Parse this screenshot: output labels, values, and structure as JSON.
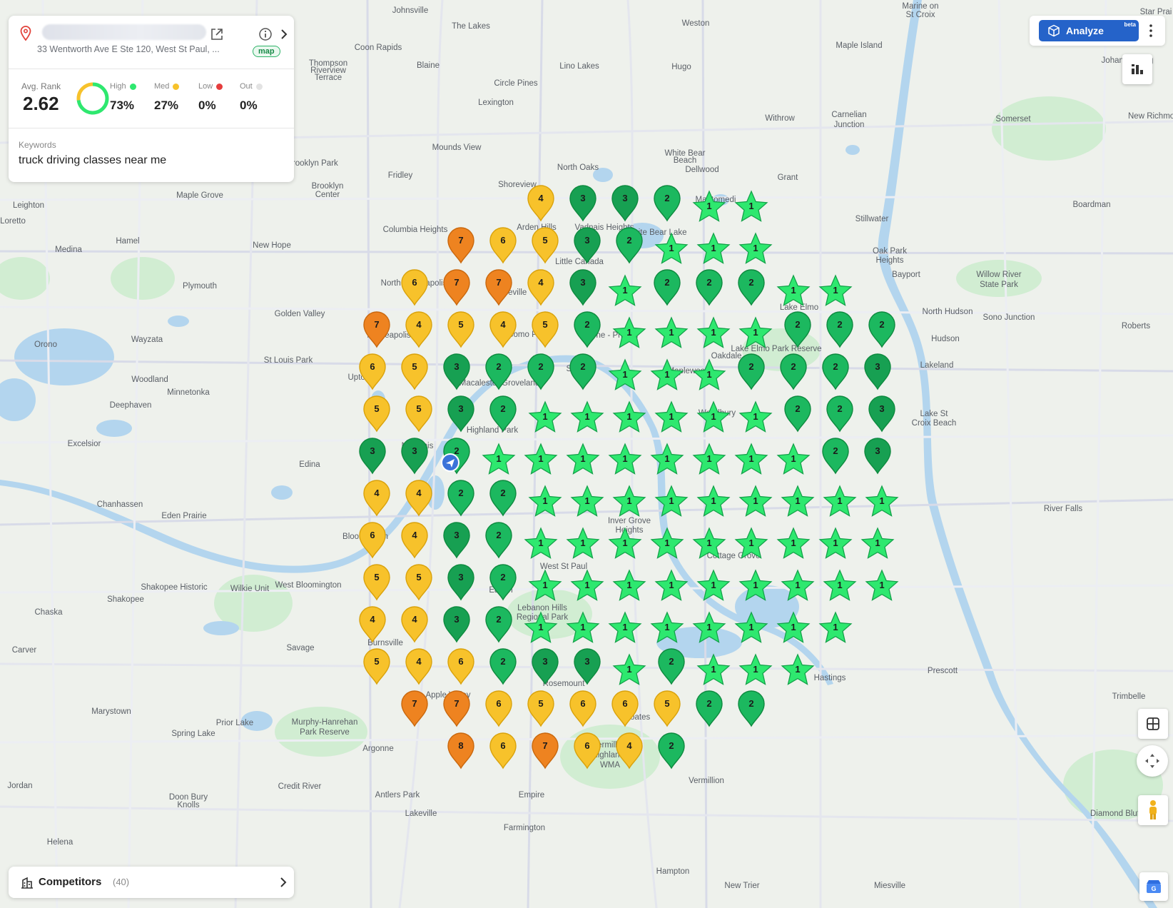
{
  "header": {
    "address": "33 Wentworth Ave E Ste 120, West St Paul, ...",
    "map_badge": "map"
  },
  "stats": {
    "avg_rank_label": "Avg. Rank",
    "avg_rank": "2.62",
    "high_label": "High",
    "high_pct": "73%",
    "med_label": "Med",
    "med_pct": "27%",
    "low_label": "Low",
    "low_pct": "0%",
    "out_label": "Out",
    "out_pct": "0%",
    "high_fraction": 0.73,
    "med_fraction": 0.27
  },
  "keywords": {
    "label": "Keywords",
    "value": "truck driving classes near me"
  },
  "competitors": {
    "label": "Competitors",
    "count": "(40)"
  },
  "toolbar": {
    "analyze_label": "Analyze",
    "beta_label": "beta"
  },
  "colors": {
    "rank_1": "#2ee86f",
    "rank_2": "#1cb85f",
    "rank_3": "#17a052",
    "rank_4_6": "#f7c22b",
    "rank_7_8": "#ee8320",
    "accent": "#2563c9"
  },
  "rank_grid": [
    [
      null,
      null,
      null,
      null,
      4,
      3,
      3,
      2,
      1,
      1,
      null,
      null,
      null,
      null
    ],
    [
      null,
      null,
      7,
      6,
      5,
      3,
      2,
      1,
      1,
      1,
      null,
      null,
      null,
      null
    ],
    [
      null,
      6,
      7,
      7,
      4,
      3,
      1,
      2,
      2,
      2,
      1,
      1,
      null,
      null
    ],
    [
      7,
      4,
      5,
      4,
      5,
      2,
      1,
      1,
      1,
      1,
      2,
      2,
      2,
      null
    ],
    [
      6,
      5,
      3,
      2,
      2,
      2,
      1,
      1,
      1,
      2,
      2,
      2,
      3,
      null
    ],
    [
      5,
      5,
      3,
      2,
      1,
      1,
      1,
      1,
      1,
      1,
      2,
      2,
      3,
      null
    ],
    [
      3,
      3,
      2,
      1,
      1,
      1,
      1,
      1,
      1,
      1,
      1,
      2,
      3,
      null
    ],
    [
      4,
      4,
      2,
      2,
      1,
      1,
      1,
      1,
      1,
      1,
      1,
      1,
      1,
      null
    ],
    [
      6,
      4,
      3,
      2,
      1,
      1,
      1,
      1,
      1,
      1,
      1,
      1,
      1,
      null
    ],
    [
      5,
      5,
      3,
      2,
      1,
      1,
      1,
      1,
      1,
      1,
      1,
      1,
      1,
      null
    ],
    [
      4,
      4,
      3,
      2,
      1,
      1,
      1,
      1,
      1,
      1,
      1,
      1,
      null,
      null
    ],
    [
      5,
      4,
      6,
      2,
      3,
      3,
      1,
      2,
      1,
      1,
      1,
      null,
      null,
      null
    ],
    [
      null,
      7,
      7,
      6,
      5,
      6,
      6,
      5,
      2,
      2,
      null,
      null,
      null,
      null
    ],
    [
      null,
      null,
      8,
      6,
      7,
      6,
      4,
      2,
      null,
      null,
      null,
      null,
      null,
      null
    ]
  ],
  "place_labels": [
    [
      "Johnsville",
      575,
      18
    ],
    [
      "The Lakes",
      660,
      40
    ],
    [
      "Weston",
      975,
      36
    ],
    [
      "Marine on",
      1290,
      12
    ],
    [
      "St Croix",
      1290,
      24
    ],
    [
      "Star Prai",
      1620,
      20
    ],
    [
      "Coon Rapids",
      530,
      70
    ],
    [
      "Thompson",
      460,
      92
    ],
    [
      "Riverview",
      460,
      102
    ],
    [
      "Terrace",
      460,
      112
    ],
    [
      "Blaine",
      600,
      95
    ],
    [
      "Lino Lakes",
      812,
      96
    ],
    [
      "Hugo",
      955,
      97
    ],
    [
      "Maple Island",
      1204,
      67
    ],
    [
      "Johannesburg",
      1580,
      88
    ],
    [
      "Circle Pines",
      723,
      120
    ],
    [
      "Lexington",
      695,
      147
    ],
    [
      "Withrow",
      1093,
      169
    ],
    [
      "Carnelian",
      1190,
      164
    ],
    [
      "Junction",
      1190,
      178
    ],
    [
      "Somerset",
      1420,
      170
    ],
    [
      "Mounds View",
      640,
      210
    ],
    [
      "New Richmond",
      1620,
      166
    ],
    [
      "Brooklyn Park",
      438,
      232
    ],
    [
      "North Oaks",
      810,
      238
    ],
    [
      "White Bear",
      960,
      218
    ],
    [
      "Beach",
      960,
      228
    ],
    [
      "Dellwood",
      984,
      241
    ],
    [
      "Fridley",
      561,
      249
    ],
    [
      "Grant",
      1104,
      252
    ],
    [
      "Brooklyn",
      459,
      264
    ],
    [
      "Center",
      459,
      276
    ],
    [
      "Maple Grove",
      280,
      277
    ],
    [
      "Leighton",
      40,
      291
    ],
    [
      "Boardman",
      1530,
      290
    ],
    [
      "Loretto",
      18,
      313
    ],
    [
      "Stillwater",
      1222,
      310
    ],
    [
      "Hamel",
      179,
      341
    ],
    [
      "Medina",
      96,
      353
    ],
    [
      "New Hope",
      381,
      347
    ],
    [
      "Oak Park",
      1247,
      355
    ],
    [
      "Heights",
      1247,
      368
    ],
    [
      "Bayport",
      1270,
      388
    ],
    [
      "Willow River",
      1400,
      388
    ],
    [
      "State Park",
      1400,
      402
    ],
    [
      "Plymouth",
      280,
      404
    ],
    [
      "Golden Valley",
      420,
      443
    ],
    [
      "North Hudson",
      1328,
      440
    ],
    [
      "Sono Junction",
      1414,
      448
    ],
    [
      "Roberts",
      1592,
      460
    ],
    [
      "Lake Elmo",
      1120,
      434
    ],
    [
      "Minneapolis",
      545,
      473
    ],
    [
      "St Paul",
      812,
      520
    ],
    [
      "Hudson",
      1325,
      478
    ],
    [
      "Orono",
      64,
      486
    ],
    [
      "Wayzata",
      206,
      479
    ],
    [
      "St Louis Park",
      404,
      508
    ],
    [
      "Lakeland",
      1313,
      515
    ],
    [
      "Woodland",
      210,
      535
    ],
    [
      "Minnetonka",
      264,
      553
    ],
    [
      "Deephaven",
      183,
      571
    ],
    [
      "Uptown",
      507,
      532
    ],
    [
      "Excelsior",
      118,
      625
    ],
    [
      "Nokomis",
      585,
      628
    ],
    [
      "Edina",
      434,
      654
    ],
    [
      "Lake St",
      1309,
      583
    ],
    [
      "Croix Beach",
      1309,
      596
    ],
    [
      "Chanhassen",
      168,
      710
    ],
    [
      "Eden Prairie",
      258,
      726
    ],
    [
      "River Falls",
      1490,
      716
    ],
    [
      "Bloomington",
      512,
      755
    ],
    [
      "West St Paul",
      790,
      797
    ],
    [
      "Inver Grove",
      882,
      733
    ],
    [
      "Heights",
      882,
      746
    ],
    [
      "Cottage Grove",
      1028,
      782
    ],
    [
      "Shakopee",
      176,
      843
    ],
    [
      "Eagan",
      702,
      830
    ],
    [
      "Lebanon Hills",
      760,
      855
    ],
    [
      "Regional Park",
      760,
      868
    ],
    [
      "Chaska",
      68,
      861
    ],
    [
      "Burnsville",
      540,
      904
    ],
    [
      "Savage",
      421,
      911
    ],
    [
      "Carver",
      34,
      914
    ],
    [
      "Hastings",
      1163,
      953
    ],
    [
      "Prescott",
      1321,
      943
    ],
    [
      "Apple Valley",
      628,
      977
    ],
    [
      "Rosemount",
      790,
      961
    ],
    [
      "Coates",
      893,
      1008
    ],
    [
      "Trimbelle",
      1582,
      979
    ],
    [
      "Marystown",
      156,
      1000
    ],
    [
      "Prior Lake",
      329,
      1016
    ],
    [
      "Spring Lake",
      271,
      1031
    ],
    [
      "Murphy-Hanrehan",
      455,
      1015
    ],
    [
      "Park Reserve",
      455,
      1029
    ],
    [
      "Vermillion",
      855,
      1047
    ],
    [
      "Highlands",
      855,
      1061
    ],
    [
      "WMA",
      855,
      1075
    ],
    [
      "Argonne",
      530,
      1052
    ],
    [
      "Credit River",
      420,
      1105
    ],
    [
      "Vermillion",
      990,
      1097
    ],
    [
      "Jordan",
      28,
      1104
    ],
    [
      "Empire",
      745,
      1117
    ],
    [
      "Antlers Park",
      557,
      1117
    ],
    [
      "Doon Bury",
      264,
      1120
    ],
    [
      "Knolls",
      264,
      1131
    ],
    [
      "Lakeville",
      590,
      1143
    ],
    [
      "Diamond Bluff",
      1564,
      1143
    ],
    [
      "Farmington",
      735,
      1163
    ],
    [
      "Helena",
      84,
      1183
    ],
    [
      "Hampton",
      943,
      1224
    ],
    [
      "New Trier",
      1040,
      1244
    ],
    [
      "Miesville",
      1247,
      1244
    ],
    [
      "Shakopee Historic",
      244,
      826
    ],
    [
      "West Bloomington",
      432,
      823
    ],
    [
      "Wilkie Unit",
      350,
      828
    ],
    [
      "Columbia Heights",
      582,
      325
    ],
    [
      "Arden Hills",
      752,
      322
    ],
    [
      "Shoreview",
      725,
      262
    ],
    [
      "Vadnais Heights",
      847,
      322
    ],
    [
      "White Bear Lake",
      920,
      329
    ],
    [
      "Mahtomedi",
      1003,
      283
    ],
    [
      "Little Canada",
      812,
      370
    ],
    [
      "Roseville",
      715,
      413
    ],
    [
      "North Minneapolis",
      580,
      400
    ],
    [
      "Maplewood",
      965,
      523
    ],
    [
      "Oakdale",
      1018,
      502
    ],
    [
      "Lake Elmo Park Reserve",
      1088,
      492
    ],
    [
      "Woodbury",
      1005,
      582
    ],
    [
      "Highland Park",
      690,
      606
    ],
    [
      "Macalester Groveland",
      700,
      540
    ],
    [
      "Payne - Phalen",
      855,
      473
    ],
    [
      "Como Park",
      740,
      472
    ]
  ]
}
